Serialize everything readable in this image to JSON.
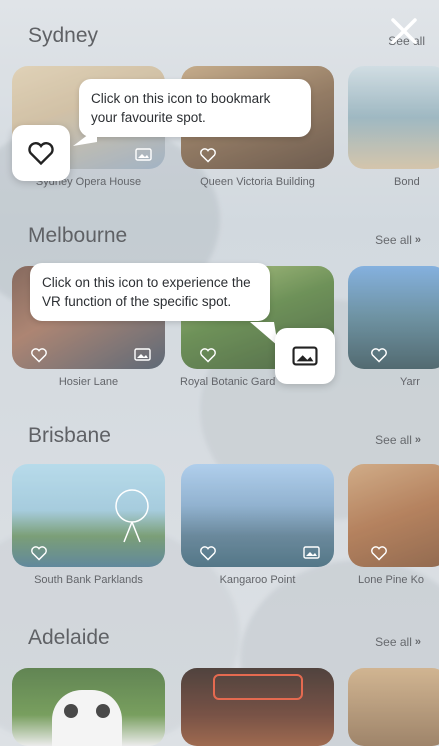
{
  "close_label": "close",
  "see_all": "See all",
  "sections": [
    {
      "city": "Sydney",
      "cards": [
        "Sydney Opera House",
        "Queen Victoria Building",
        "Bond"
      ]
    },
    {
      "city": "Melbourne",
      "cards": [
        "Hosier Lane",
        "Royal Botanic Gard",
        "Yarr"
      ]
    },
    {
      "city": "Brisbane",
      "cards": [
        "South Bank Parklands",
        "Kangaroo Point",
        "Lone Pine Ko"
      ]
    },
    {
      "city": "Adelaide",
      "cards": [
        "",
        "",
        ""
      ]
    }
  ],
  "tooltips": {
    "bookmark": "Click on this icon to bookmark your favourite spot.",
    "vr": "Click on this icon to experience the VR function of the specific spot."
  },
  "icons": {
    "close": "close-icon",
    "bookmark": "heart-icon",
    "vr": "vr-icon",
    "chevron": "double-chevron-icon"
  },
  "colors": {
    "tooltip_bg": "#ffffff",
    "text": "#3c3f44"
  }
}
